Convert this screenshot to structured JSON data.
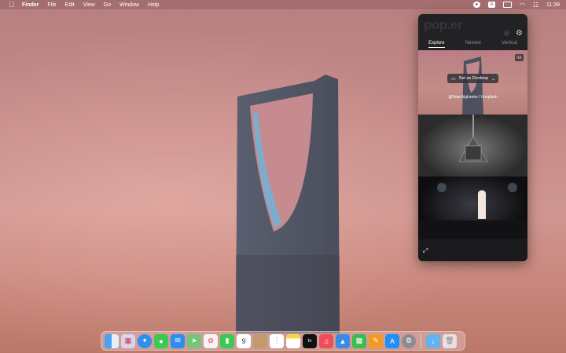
{
  "menubar": {
    "app_name": "Finder",
    "items": [
      "File",
      "Edit",
      "View",
      "Go",
      "Window",
      "Help"
    ],
    "tray": {
      "popper_icon": "popper-icon",
      "input_source": "A",
      "clock": "11:39"
    }
  },
  "popup": {
    "logo": "pop.er",
    "tabs": [
      "Explore",
      "Newest",
      "Vertical"
    ],
    "active_tab": "Explore",
    "badge": "SK",
    "set_desktop_label": "Set as Desktop",
    "credit": "@Haia Alghanim / Unsplash"
  },
  "dock": {
    "calendar_day": "9",
    "apps": [
      "finder",
      "launchpad",
      "safari",
      "messages",
      "mail",
      "maps",
      "photos",
      "facetime",
      "calendar",
      "contacts",
      "reminders",
      "notes",
      "tv",
      "music",
      "keynote",
      "numbers",
      "pages",
      "app-store",
      "system-preferences",
      "downloads",
      "trash"
    ]
  },
  "colors": {
    "menubar": "#96606480",
    "popup_bg": "#1f1f21",
    "accent": "#ffffff"
  }
}
